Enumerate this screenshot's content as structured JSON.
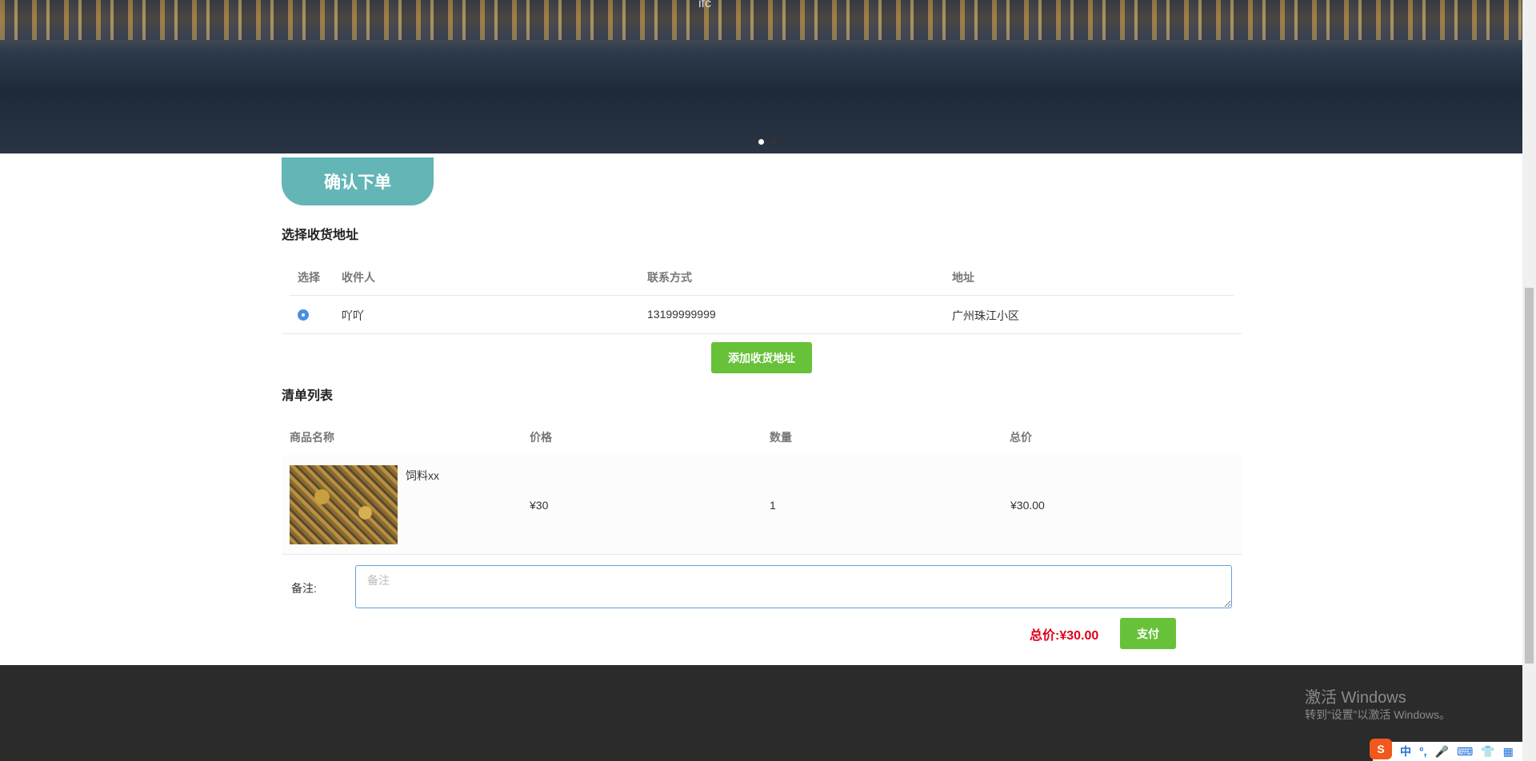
{
  "banner": {
    "sign": "ifc",
    "slides": 2,
    "active_slide": 1
  },
  "page_tab": "确认下单",
  "address": {
    "title": "选择收货地址",
    "headers": [
      "选择",
      "收件人",
      "联系方式",
      "地址"
    ],
    "rows": [
      {
        "name": "吖吖",
        "phone": "13199999999",
        "address": "广州珠江小区",
        "selected": true
      }
    ],
    "add_button": "添加收货地址"
  },
  "order": {
    "title": "清单列表",
    "headers": [
      "商品名称",
      "价格",
      "数量",
      "总价"
    ],
    "items": [
      {
        "name": "饲料xx",
        "price": "¥30",
        "qty": "1",
        "total": "¥30.00"
      }
    ]
  },
  "remark": {
    "label": "备注:",
    "placeholder": "备注",
    "value": ""
  },
  "summary": {
    "total_label": "总价:",
    "total": "¥30.00",
    "pay_button": "支付"
  },
  "watermark": {
    "title": "激活 Windows",
    "subtitle": "转到“设置”以激活 Windows。"
  },
  "tray": {
    "ime": "S",
    "lang": "中",
    "punct": "°,"
  }
}
